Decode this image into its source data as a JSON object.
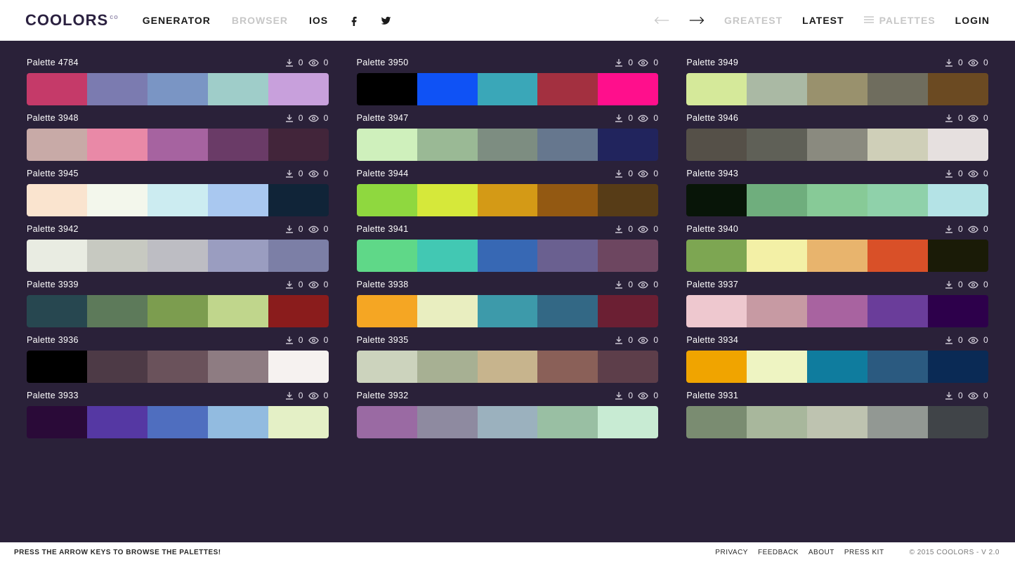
{
  "logo": {
    "text": "COOLORS",
    "sup": "co"
  },
  "nav": {
    "generator": "GENERATOR",
    "browser": "BROWSER",
    "ios": "IOS",
    "greatest": "GREATEST",
    "latest": "LATEST",
    "palettes": "PALETTES",
    "login": "LOGIN"
  },
  "footer": {
    "hint": "PRESS THE ARROW KEYS TO BROWSE THE PALETTES!",
    "privacy": "PRIVACY",
    "feedback": "FEEDBACK",
    "about": "ABOUT",
    "presskit": "PRESS KIT",
    "copyright": "© 2015 COOLORS - V 2.0"
  },
  "palettes": [
    {
      "title": "Palette 4784",
      "downloads": "0",
      "views": "0",
      "colors": [
        "#c53a69",
        "#7b7bb0",
        "#7a95c4",
        "#9fcdc9",
        "#c8a0dc"
      ]
    },
    {
      "title": "Palette 3950",
      "downloads": "0",
      "views": "0",
      "colors": [
        "#000000",
        "#0f52f5",
        "#3aa7b8",
        "#a33040",
        "#ff0f8c"
      ]
    },
    {
      "title": "Palette 3949",
      "downloads": "0",
      "views": "0",
      "colors": [
        "#d5e99a",
        "#aab9a4",
        "#99916d",
        "#6f6d5e",
        "#6b4a22"
      ]
    },
    {
      "title": "Palette 3948",
      "downloads": "0",
      "views": "0",
      "colors": [
        "#c8aaa7",
        "#e989a7",
        "#a663a0",
        "#6a3b67",
        "#42253a"
      ]
    },
    {
      "title": "Palette 3947",
      "downloads": "0",
      "views": "0",
      "colors": [
        "#cff0bc",
        "#9ab995",
        "#7d8d81",
        "#66778e",
        "#21245d"
      ]
    },
    {
      "title": "Palette 3946",
      "downloads": "0",
      "views": "0",
      "colors": [
        "#555048",
        "#5f6057",
        "#8a8a7f",
        "#cfcfb8",
        "#e6e0df"
      ]
    },
    {
      "title": "Palette 3945",
      "downloads": "0",
      "views": "0",
      "colors": [
        "#fae4cf",
        "#f3f7ec",
        "#ccecf1",
        "#a9c8f0",
        "#102438"
      ]
    },
    {
      "title": "Palette 3944",
      "downloads": "0",
      "views": "0",
      "colors": [
        "#8fd83f",
        "#d6e83a",
        "#d49a16",
        "#935912",
        "#573c17"
      ]
    },
    {
      "title": "Palette 3943",
      "downloads": "0",
      "views": "0",
      "colors": [
        "#081508",
        "#6fae7d",
        "#87ca97",
        "#8fd1aa",
        "#b4e3e6"
      ]
    },
    {
      "title": "Palette 3942",
      "downloads": "0",
      "views": "0",
      "colors": [
        "#e9ece2",
        "#c7c9c1",
        "#bdbdc3",
        "#9a9dc0",
        "#7c7fa6"
      ]
    },
    {
      "title": "Palette 3941",
      "downloads": "0",
      "views": "0",
      "colors": [
        "#5fd888",
        "#42c8b3",
        "#3768b4",
        "#6a6090",
        "#6d4660"
      ]
    },
    {
      "title": "Palette 3940",
      "downloads": "0",
      "views": "0",
      "colors": [
        "#7da652",
        "#f3f0a6",
        "#e8b46d",
        "#d95028",
        "#1a1b07"
      ]
    },
    {
      "title": "Palette 3939",
      "downloads": "0",
      "views": "0",
      "colors": [
        "#274750",
        "#5d7a5a",
        "#7c9d4f",
        "#c0d68c",
        "#8a1c1c"
      ]
    },
    {
      "title": "Palette 3938",
      "downloads": "0",
      "views": "0",
      "colors": [
        "#f5a623",
        "#e9eec0",
        "#3d9aaa",
        "#336885",
        "#6b1f33"
      ]
    },
    {
      "title": "Palette 3937",
      "downloads": "0",
      "views": "0",
      "colors": [
        "#eec8cf",
        "#c79aa3",
        "#a863a0",
        "#6a3d9a",
        "#2d004b"
      ]
    },
    {
      "title": "Palette 3936",
      "downloads": "0",
      "views": "0",
      "colors": [
        "#000000",
        "#4d3a46",
        "#6a525b",
        "#8e7c82",
        "#f6f2f0"
      ]
    },
    {
      "title": "Palette 3935",
      "downloads": "0",
      "views": "0",
      "colors": [
        "#ccd3bd",
        "#a7b093",
        "#c7b48d",
        "#8a6058",
        "#5d3e4a"
      ]
    },
    {
      "title": "Palette 3934",
      "downloads": "0",
      "views": "0",
      "colors": [
        "#f0a400",
        "#eef4c2",
        "#0f7c9e",
        "#2b5a80",
        "#0a2a55"
      ]
    },
    {
      "title": "Palette 3933",
      "downloads": "0",
      "views": "0",
      "colors": [
        "#2a0a38",
        "#5538a3",
        "#4f6ebf",
        "#92bbe0",
        "#e4f0c6"
      ]
    },
    {
      "title": "Palette 3932",
      "downloads": "0",
      "views": "0",
      "colors": [
        "#9a6aa3",
        "#8e8aa0",
        "#9bb1be",
        "#99bfa3",
        "#c8ebd3"
      ]
    },
    {
      "title": "Palette 3931",
      "downloads": "0",
      "views": "0",
      "colors": [
        "#7a8c71",
        "#a8b79c",
        "#bec3b0",
        "#929893",
        "#404448"
      ]
    }
  ]
}
